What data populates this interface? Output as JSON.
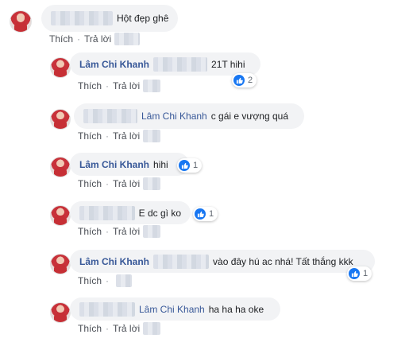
{
  "ui": {
    "like_label": "Thích",
    "reply_label": "Trả lời",
    "separator": "·"
  },
  "comments": [
    {
      "text": "Hột đẹp ghê"
    },
    {
      "author": "Lâm Chi Khanh",
      "text": "21T hihi",
      "reactions": "2"
    },
    {
      "author": "Lâm Chi Khanh",
      "text": "c gái e vượng quá"
    },
    {
      "author": "Lâm Chi Khanh",
      "text": "hihi",
      "reactions": "1"
    },
    {
      "text": "E dc gì ko",
      "reactions": "1"
    },
    {
      "author": "Lâm Chi Khanh",
      "text": "vào đây hú ac nhá! Tất thắng kkk",
      "reactions": "1"
    },
    {
      "author": "Lâm Chi Khanh",
      "text": "ha ha ha oke"
    }
  ],
  "colors": {
    "bubble_bg": "#f2f3f5",
    "name": "#385898",
    "like_blue": "#1877f2"
  }
}
